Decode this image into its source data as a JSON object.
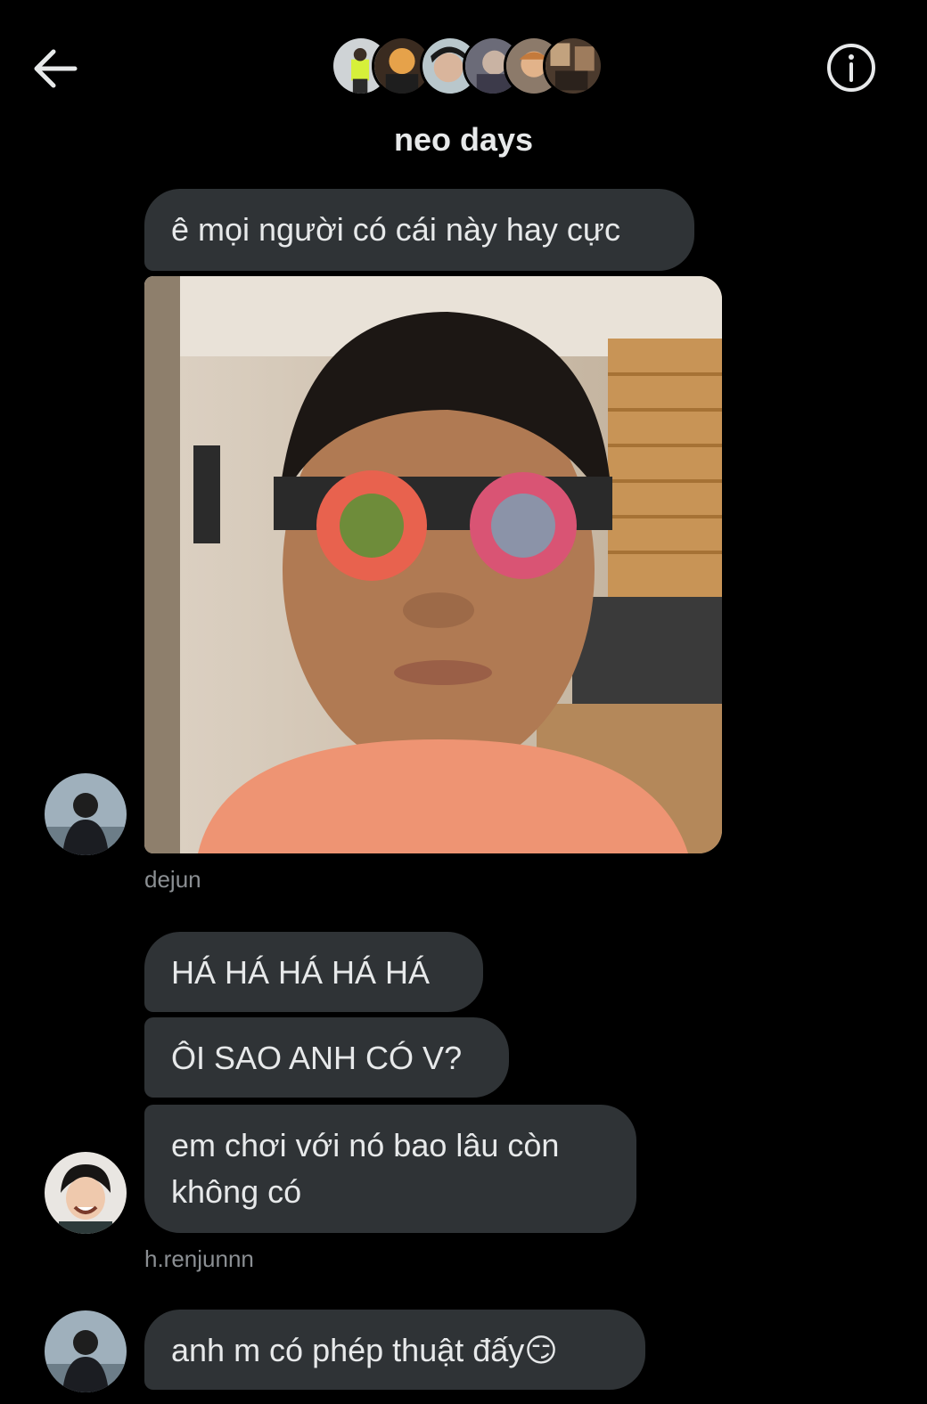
{
  "header": {
    "title": "neo days",
    "back_icon": "arrow-left-icon",
    "info_icon": "info-icon",
    "member_avatar_count": 6
  },
  "messages": [
    {
      "sender": "dejun",
      "items": [
        {
          "type": "text",
          "text": "ê mọi người có cái này hay cực"
        },
        {
          "type": "image",
          "alt": "photo"
        }
      ]
    },
    {
      "sender": "h.renjunnn",
      "items": [
        {
          "type": "text",
          "text": "HÁ HÁ HÁ HÁ HÁ"
        },
        {
          "type": "text",
          "text": "ÔI SAO ANH CÓ V?"
        },
        {
          "type": "text",
          "text": "em chơi với nó bao lâu còn không có"
        }
      ]
    },
    {
      "sender": "dejun",
      "items": [
        {
          "type": "text",
          "text": "anh m có phép thuật đấy😏"
        }
      ]
    }
  ],
  "colors": {
    "background": "#000000",
    "bubble": "#2f3336",
    "text": "#e7e9ea",
    "muted": "#8b8f93"
  }
}
